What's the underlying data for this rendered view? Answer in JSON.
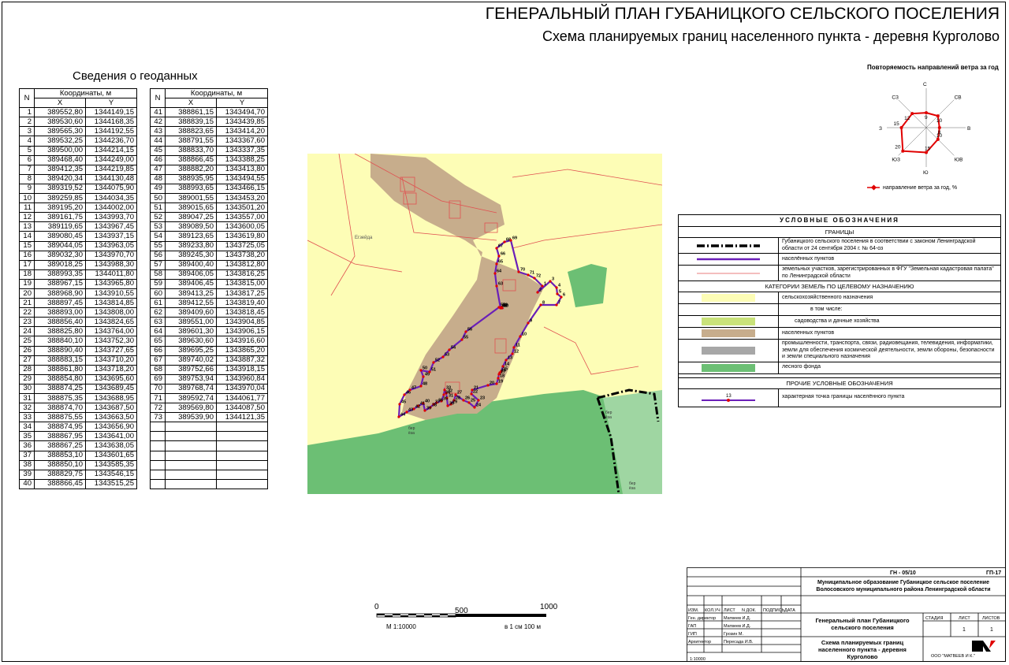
{
  "title_main": "ГЕНЕРАЛЬНЫЙ ПЛАН ГУБАНИЦКОГО СЕЛЬСКОГО ПОСЕЛЕНИЯ",
  "title_sub": "Схема планируемых границ населенного пункта - деревня Курголово",
  "geo": {
    "title": "Сведения о геоданных",
    "col_n": "N",
    "col_coords": "Координаты, м",
    "col_x": "X",
    "col_y": "Y",
    "left": [
      [
        "1",
        "389552,80",
        "1344149,15"
      ],
      [
        "2",
        "389530,60",
        "1344168,35"
      ],
      [
        "3",
        "389565,30",
        "1344192,55"
      ],
      [
        "4",
        "389532,25",
        "1344236,70"
      ],
      [
        "5",
        "389500,00",
        "1344214,15"
      ],
      [
        "6",
        "389468,40",
        "1344249,00"
      ],
      [
        "7",
        "389412,35",
        "1344219,85"
      ],
      [
        "8",
        "389420,34",
        "1344130,48"
      ],
      [
        "9",
        "389319,52",
        "1344075,90"
      ],
      [
        "10",
        "389259,85",
        "1344034,35"
      ],
      [
        "11",
        "389195,20",
        "1344002,00"
      ],
      [
        "12",
        "389161,75",
        "1343993,70"
      ],
      [
        "13",
        "389119,65",
        "1343967,45"
      ],
      [
        "14",
        "389080,45",
        "1343937,15"
      ],
      [
        "15",
        "389044,05",
        "1343963,05"
      ],
      [
        "16",
        "389032,30",
        "1343970,70"
      ],
      [
        "17",
        "389018,25",
        "1343988,30"
      ],
      [
        "18",
        "388993,35",
        "1344011,80"
      ],
      [
        "19",
        "388967,15",
        "1343965,80"
      ],
      [
        "20",
        "388968,90",
        "1343910,55"
      ],
      [
        "21",
        "388897,45",
        "1343814,85"
      ],
      [
        "22",
        "388893,00",
        "1343808,00"
      ],
      [
        "23",
        "388856,40",
        "1343824,65"
      ],
      [
        "24",
        "388825,80",
        "1343764,00"
      ],
      [
        "25",
        "388840,10",
        "1343752,30"
      ],
      [
        "26",
        "388890,40",
        "1343727,65"
      ],
      [
        "27",
        "388883,15",
        "1343710,20"
      ],
      [
        "28",
        "388861,80",
        "1343718,20"
      ],
      [
        "29",
        "388854,80",
        "1343695,60"
      ],
      [
        "30",
        "388874,25",
        "1343689,45"
      ],
      [
        "31",
        "388875,35",
        "1343688,95"
      ],
      [
        "32",
        "388874,70",
        "1343687,50"
      ],
      [
        "33",
        "388875,55",
        "1343663,50"
      ],
      [
        "34",
        "388874,95",
        "1343656,90"
      ],
      [
        "35",
        "388867,95",
        "1343641,00"
      ],
      [
        "36",
        "388867,25",
        "1343638,05"
      ],
      [
        "37",
        "388853,10",
        "1343601,65"
      ],
      [
        "38",
        "388850,10",
        "1343585,35"
      ],
      [
        "39",
        "388829,75",
        "1343546,15"
      ],
      [
        "40",
        "388866,45",
        "1343515,25"
      ]
    ],
    "right": [
      [
        "41",
        "388861,15",
        "1343494,70"
      ],
      [
        "42",
        "388839,15",
        "1343439,85"
      ],
      [
        "43",
        "388823,65",
        "1343414,20"
      ],
      [
        "44",
        "388791,55",
        "1343367,60"
      ],
      [
        "45",
        "388833,70",
        "1343337,35"
      ],
      [
        "46",
        "388866,45",
        "1343388,25"
      ],
      [
        "47",
        "388882,20",
        "1343413,80"
      ],
      [
        "48",
        "388935,95",
        "1343494,55"
      ],
      [
        "49",
        "388993,65",
        "1343466,15"
      ],
      [
        "50",
        "389001,55",
        "1343453,20"
      ],
      [
        "51",
        "389015,65",
        "1343501,20"
      ],
      [
        "52",
        "389047,25",
        "1343557,00"
      ],
      [
        "53",
        "389089,50",
        "1343600,05"
      ],
      [
        "54",
        "389123,65",
        "1343619,80"
      ],
      [
        "55",
        "389233,80",
        "1343725,05"
      ],
      [
        "56",
        "389245,30",
        "1343738,20"
      ],
      [
        "57",
        "389400,40",
        "1343812,80"
      ],
      [
        "58",
        "389406,05",
        "1343816,25"
      ],
      [
        "59",
        "389406,45",
        "1343815,00"
      ],
      [
        "60",
        "389413,25",
        "1343817,25"
      ],
      [
        "61",
        "389412,55",
        "1343819,40"
      ],
      [
        "62",
        "389409,60",
        "1343818,45"
      ],
      [
        "63",
        "389551,00",
        "1343904,85"
      ],
      [
        "64",
        "389601,30",
        "1343906,15"
      ],
      [
        "65",
        "389630,60",
        "1343916,60"
      ],
      [
        "66",
        "389695,25",
        "1343865,20"
      ],
      [
        "67",
        "389740,02",
        "1343887,32"
      ],
      [
        "68",
        "389752,66",
        "1343918,15"
      ],
      [
        "69",
        "389753,94",
        "1343960,84"
      ],
      [
        "70",
        "389768,74",
        "1343970,04"
      ],
      [
        "71",
        "389592,74",
        "1344061,77"
      ],
      [
        "72",
        "389569,80",
        "1344087,50"
      ],
      [
        "73",
        "389539,90",
        "1344121,35"
      ]
    ]
  },
  "map": {
    "labels": [
      {
        "text": "Егзейда",
        "id": "l1"
      },
      {
        "text": "бер",
        "id": "l2"
      },
      {
        "text": "ёза",
        "id": "l3"
      },
      {
        "text": "бер",
        "id": "l4"
      },
      {
        "text": "ёза",
        "id": "l5"
      },
      {
        "text": "бер",
        "id": "l6"
      },
      {
        "text": "ёза",
        "id": "l7"
      }
    ],
    "points": [
      "1",
      "2",
      "3",
      "4",
      "5",
      "6",
      "7",
      "8",
      "9",
      "10",
      "11",
      "12",
      "13",
      "14",
      "15",
      "16",
      "17",
      "18",
      "19",
      "20",
      "21",
      "22",
      "23",
      "24",
      "25",
      "26",
      "27",
      "28",
      "29",
      "30",
      "31",
      "32",
      "33",
      "34",
      "35",
      "36",
      "37",
      "38",
      "39",
      "40",
      "41",
      "42",
      "43",
      "44",
      "45",
      "46",
      "47",
      "48",
      "49",
      "50",
      "51",
      "52",
      "53",
      "54",
      "55",
      "56",
      "57",
      "58",
      "59",
      "60",
      "61",
      "62",
      "63",
      "64",
      "65",
      "66",
      "67",
      "68",
      "69",
      "70",
      "71",
      "72",
      "73"
    ]
  },
  "wind": {
    "title": "Повторяемость направлений ветра за год",
    "directions": [
      "С",
      "СВ",
      "В",
      "ЮВ",
      "Ю",
      "ЮЗ",
      "З",
      "СЗ"
    ],
    "values": [
      9,
      10,
      8,
      10,
      15,
      20,
      15,
      12
    ],
    "legend": "направление ветра за год, %",
    "color": "#e00000"
  },
  "legend": {
    "title": "УСЛОВНЫЕ ОБОЗНАЧЕНИЯ",
    "sec1": "ГРАНИЦЫ",
    "b1": "Губаницкого сельского поселения в соответствии с законом Ленинградской области от 24 сентября 2004 г. № 64-оз",
    "b2": "населённых пунктов",
    "b3": "земельных участков, зарегистрированных в ФГУ \"Земельная кадастровая палата\" по Ленинградской области",
    "sec2": "КАТЕГОРИИ ЗЕМЕЛЬ ПО ЦЕЛЕВОМУ НАЗНАЧЕНИЮ",
    "c1": "сельскохозяйственного назначения",
    "c2": "в том числе:",
    "c3": "садоводства и дачные хозяйства",
    "c4": "населенных пунктов",
    "c5": "промышленности, транспорта, связи, радиовещания, телевидения, информатики, земли для обеспечения космической деятельности, земли обороны, безопасности и земли специального назначения",
    "c6": "лесного фонда",
    "sec3": "ПРОЧИЕ УСЛОВНЫЕ ОБОЗНАЧЕНИЯ",
    "p1_num": "13",
    "p1": "характерная точка границы населённого пункта",
    "colors": {
      "agri": "#fdfdb6",
      "garden": "#c9e27a",
      "settl": "#c7ad8c",
      "indus": "#a7a7a7",
      "forest": "#6cbf74",
      "boundary": "#6a1fb8",
      "parcel": "#e05050"
    }
  },
  "scale": {
    "z": "0",
    "m": "500",
    "k": "1000",
    "ratio": "М 1:10000",
    "note": "в 1 см 100 м"
  },
  "stamp": {
    "code": "ГН - 05/10",
    "sheet_code": "ГП-17",
    "org": "Муниципальное образование Губаницкое сельское поселение Волосовского муниципального района Ленинградской области",
    "h": [
      "ИЗМ.",
      "КОЛ.УЧ",
      "ЛИСТ",
      "N ДОК.",
      "ПОДПИСЬ",
      "ДАТА"
    ],
    "roles": [
      [
        "Ген. директор",
        "Матвеев И.Д."
      ],
      [
        "ГАП",
        "Матвеев И.Д."
      ],
      [
        "ГИП",
        "Грозин М."
      ],
      [
        "Архитектор",
        "Пересада И.В."
      ]
    ],
    "doc_title": "Генеральный план Губаницкого сельского поселения",
    "stage_h": "СТАДИЯ",
    "list_h": "ЛИСТ",
    "lists_h": "ЛИСТОВ",
    "list": "1",
    "lists": "1",
    "sheet_title": "Схема планируемых границ населенного пункта - деревня Курголово",
    "company": "ООО \"МАТВЕЕВ И К.\"",
    "scale": "1:10000"
  }
}
